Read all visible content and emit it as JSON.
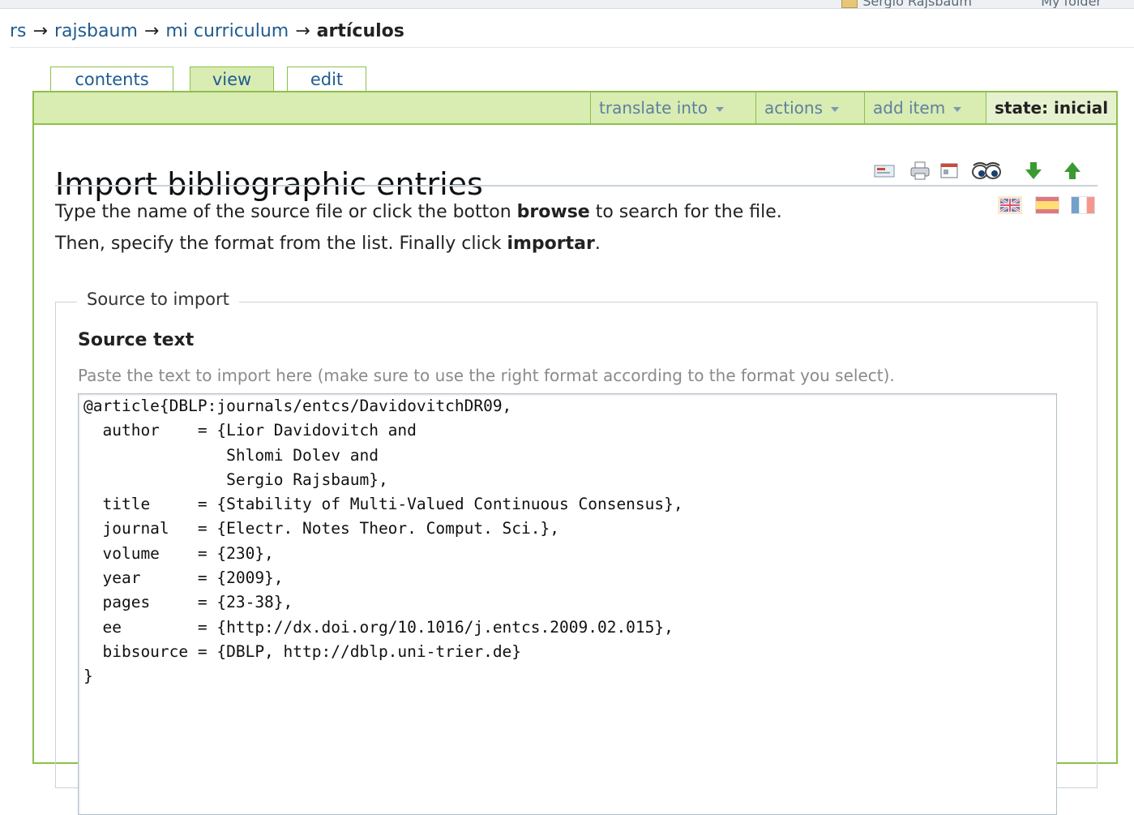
{
  "topbar": {
    "user": "Sergio Rajsbaum",
    "folder": "My folder"
  },
  "breadcrumb": {
    "items": [
      "rs",
      "rajsbaum",
      "mi curriculum"
    ],
    "current": "artículos",
    "separator": "→"
  },
  "tabs": [
    {
      "label": "contents",
      "active": false
    },
    {
      "label": "view",
      "active": true
    },
    {
      "label": "edit",
      "active": false
    }
  ],
  "actionbar": {
    "translate": "translate into",
    "actions": "actions",
    "add_item": "add item",
    "state": "state: inicial"
  },
  "page": {
    "title": "Import bibliographic entries",
    "intro_part1": "Type the name of the source file or click the botton ",
    "intro_browse": "browse",
    "intro_part2": " to search for the file. Then, specify the format from the list. Finally click ",
    "intro_import": "importar",
    "intro_part3": "."
  },
  "doc_icons": [
    "mail-icon",
    "print-icon",
    "full-screen-icon",
    "watch-icon",
    "move-down-icon",
    "move-up-icon"
  ],
  "languages": [
    "english-flag",
    "spanish-flag",
    "french-flag"
  ],
  "fieldset": {
    "legend": "Source to import",
    "label": "Source text",
    "help": "Paste the text to import here (make sure to use the right format according to the format you select).",
    "value": "@article{DBLP:journals/entcs/DavidovitchDR09,\n  author    = {Lior Davidovitch and\n               Shlomi Dolev and\n               Sergio Rajsbaum},\n  title     = {Stability of Multi-Valued Continuous Consensus},\n  journal   = {Electr. Notes Theor. Comput. Sci.},\n  volume    = {230},\n  year      = {2009},\n  pages     = {23-38},\n  ee        = {http://dx.doi.org/10.1016/j.entcs.2009.02.015},\n  bibsource = {DBLP, http://dblp.uni-trier.de}\n}"
  },
  "colors": {
    "accent_green": "#8cc04a",
    "bar_green": "#d9ecb2",
    "link_blue": "#205c90"
  }
}
